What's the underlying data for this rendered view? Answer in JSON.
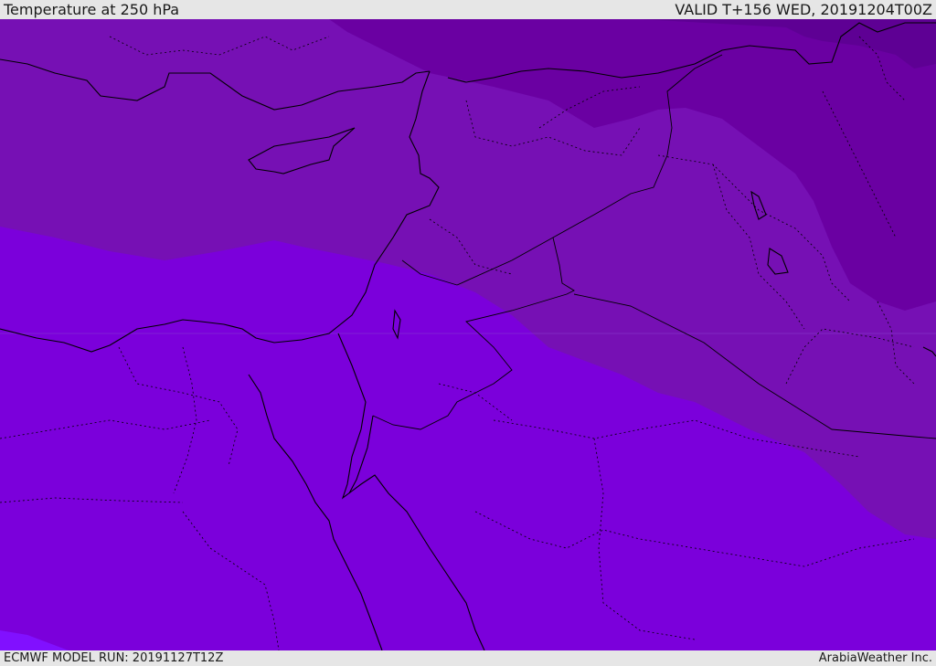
{
  "header": {
    "title": "Temperature at 250 hPa",
    "valid": "VALID T+156 WED, 20191204T00Z"
  },
  "footer": {
    "model_run": "ECMWF MODEL RUN: 20191127T12Z",
    "credit": "ArabiaWeather Inc."
  },
  "colors": {
    "band_coldest": "#5e0094",
    "band_cold": "#6a00a2",
    "band_cool": "#7610b4",
    "band_mild": "#7b00db",
    "band_warm": "#8110ff",
    "land_lines": "#000000"
  }
}
